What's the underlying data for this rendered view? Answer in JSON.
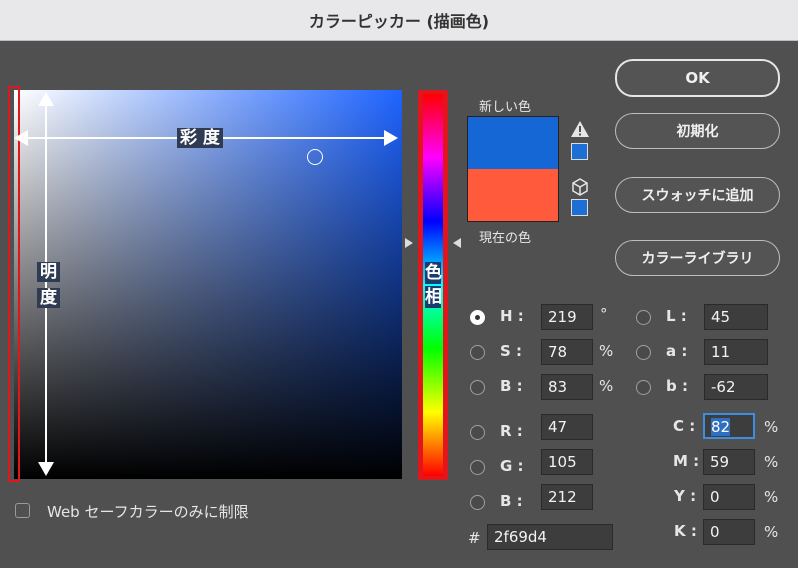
{
  "window": {
    "title": "カラーピッカー (描画色)"
  },
  "field": {
    "saturation_label": "彩 度",
    "brightness_label_1": "明",
    "brightness_label_2": "度"
  },
  "hue": {
    "label_1": "色",
    "label_2": "相"
  },
  "swatches": {
    "new_label": "新しい色",
    "current_label": "現在の色",
    "new_color": "#1667d6",
    "current_color": "#ff5a3c",
    "warning_icon": "gamut-warning-icon",
    "cube_icon": "web-safe-cube-icon"
  },
  "buttons": {
    "ok": "OK",
    "reset": "初期化",
    "add_swatch": "スウォッチに追加",
    "libraries": "カラーライブラリ"
  },
  "hsb": {
    "h": {
      "label": "H :",
      "value": "219",
      "unit": "°"
    },
    "s": {
      "label": "S :",
      "value": "78",
      "unit": "%"
    },
    "b": {
      "label": "B :",
      "value": "83",
      "unit": "%"
    }
  },
  "rgb": {
    "r": {
      "label": "R :",
      "value": "47"
    },
    "g": {
      "label": "G :",
      "value": "105"
    },
    "b": {
      "label": "B :",
      "value": "212"
    }
  },
  "lab": {
    "l": {
      "label": "L :",
      "value": "45"
    },
    "a": {
      "label": "a :",
      "value": "11"
    },
    "b": {
      "label": "b :",
      "value": "-62"
    }
  },
  "cmyk": {
    "c": {
      "label": "C :",
      "value": "82",
      "unit": "%"
    },
    "m": {
      "label": "M :",
      "value": "59",
      "unit": "%"
    },
    "y": {
      "label": "Y :",
      "value": "0",
      "unit": "%"
    },
    "k": {
      "label": "K :",
      "value": "0",
      "unit": "%"
    }
  },
  "hex": {
    "label": "#",
    "value": "2f69d4"
  },
  "web_only": {
    "label": "Web セーフカラーのみに制限",
    "checked": false
  },
  "selected_mode": "H"
}
